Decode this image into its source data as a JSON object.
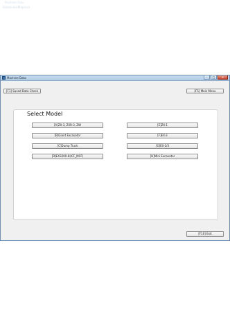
{
  "background_app": {
    "title": "Machine Data",
    "menu": [
      "Datamaker",
      "Maperch"
    ]
  },
  "window": {
    "title": "Machine Data",
    "controls": {
      "minimize": "–",
      "maximize": "□",
      "close": "✕"
    }
  },
  "toolbar": {
    "saved_data_check": "[F1] Saved Data Check",
    "main_menu": "[F5] Main Menu"
  },
  "select_model": {
    "title": "Select Model",
    "models": [
      {
        "id": "A",
        "label": "[A]ZX-3, ZXR-3, ZW"
      },
      {
        "id": "B",
        "label": "[B]Giant Excavator"
      },
      {
        "id": "C",
        "label": "[C]Dump Truck"
      },
      {
        "id": "D",
        "label": "[D]EX3200-6(ICF_MCF)"
      },
      {
        "id": "E",
        "label": "[E]ZX-1"
      },
      {
        "id": "F",
        "label": "[F]EX-3"
      },
      {
        "id": "G",
        "label": "[G]EX-2/3"
      },
      {
        "id": "H",
        "label": "[H]Mini Excavator"
      }
    ]
  },
  "footer": {
    "exit": "[F10] Exit"
  },
  "colors": {
    "titlebar": "#aecbe7",
    "window_bg": "#f0f0f0",
    "panel_bg": "#ffffff",
    "button_border": "#8c8c8c",
    "close_button": "#c7432b"
  },
  "icons": {
    "app": "app-icon"
  }
}
